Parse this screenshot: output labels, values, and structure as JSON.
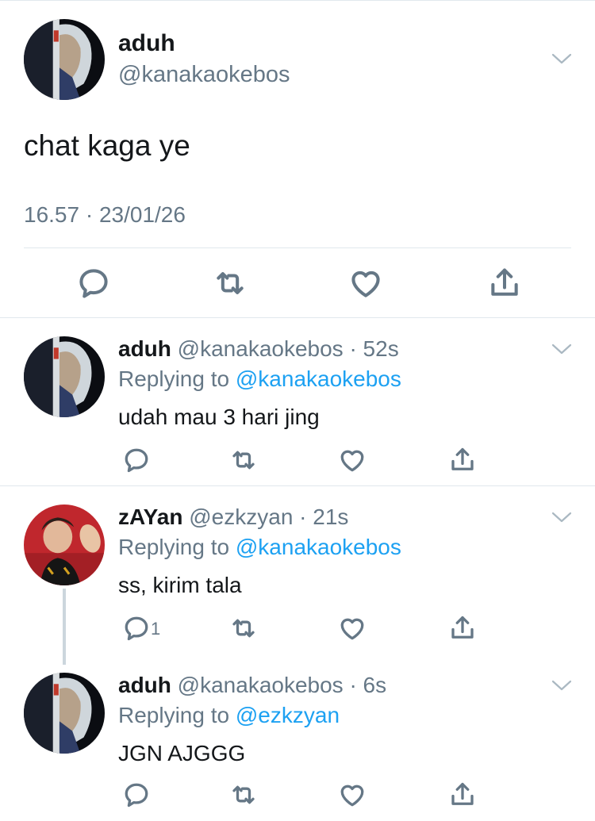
{
  "main_tweet": {
    "name": "aduh",
    "handle": "@kanakaokebos",
    "text": "chat kaga ye",
    "meta": "16.57 · 23/01/26",
    "actions": [
      "reply-icon",
      "retweet-icon",
      "like-icon",
      "share-icon"
    ]
  },
  "replies": [
    {
      "name": "aduh",
      "handle": "@kanakaokebos · 52s",
      "replying_prefix": "Replying to ",
      "replying_to": "@kanakaokebos",
      "text": "udah mau 3 hari jing",
      "reply_count": ""
    },
    {
      "name": "zAYan",
      "handle": "@ezkzyan · 21s",
      "replying_prefix": "Replying to ",
      "replying_to": "@kanakaokebos",
      "text": "ss, kirim tala",
      "reply_count": "1"
    },
    {
      "name": "aduh",
      "handle": "@kanakaokebos · 6s",
      "replying_prefix": "Replying to ",
      "replying_to": "@ezkzyan",
      "text": "JGN AJGGG",
      "reply_count": ""
    }
  ],
  "colors": {
    "text_primary": "#14171a",
    "text_secondary": "#657786",
    "link": "#1da1f2",
    "divider": "#e1e8ed",
    "thread_line": "#ccd6dd"
  }
}
